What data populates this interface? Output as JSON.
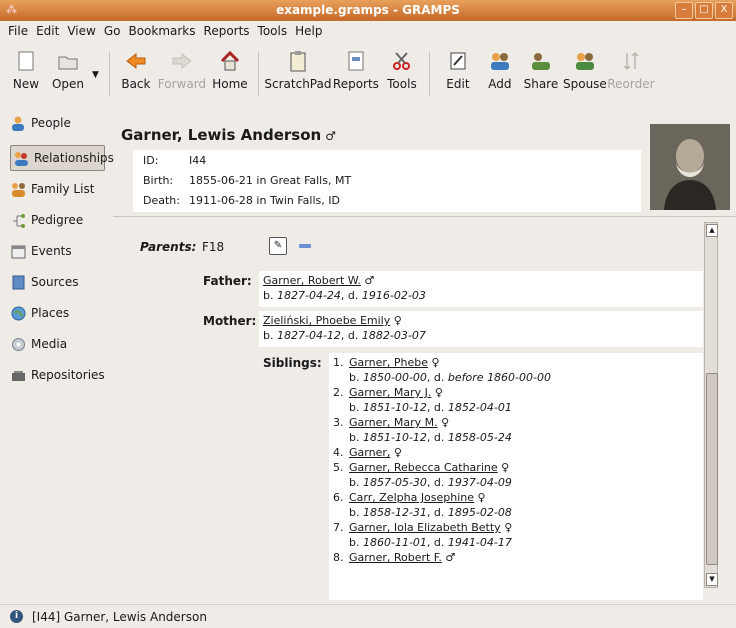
{
  "window": {
    "title": "example.gramps - GRAMPS",
    "buttons": [
      "–",
      "□",
      "X"
    ]
  },
  "menu": [
    "File",
    "Edit",
    "View",
    "Go",
    "Bookmarks",
    "Reports",
    "Tools",
    "Help"
  ],
  "toolbar": {
    "new": "New",
    "open": "Open",
    "back": "Back",
    "forward": "Forward",
    "home": "Home",
    "scratchpad": "ScratchPad",
    "reports": "Reports",
    "tools": "Tools",
    "edit": "Edit",
    "add": "Add",
    "share": "Share",
    "spouse": "Spouse",
    "reorder": "Reorder"
  },
  "sidebar": {
    "items": [
      {
        "label": "People",
        "icon": "people-icon"
      },
      {
        "label": "Relationships",
        "icon": "relationships-icon"
      },
      {
        "label": "Family List",
        "icon": "family-list-icon"
      },
      {
        "label": "Pedigree",
        "icon": "pedigree-icon"
      },
      {
        "label": "Events",
        "icon": "events-icon"
      },
      {
        "label": "Sources",
        "icon": "sources-icon"
      },
      {
        "label": "Places",
        "icon": "places-icon"
      },
      {
        "label": "Media",
        "icon": "media-icon"
      },
      {
        "label": "Repositories",
        "icon": "repositories-icon"
      }
    ],
    "active": "Relationships"
  },
  "person": {
    "name": "Garner, Lewis Anderson",
    "sex": "♂",
    "id_label": "ID:",
    "id": "I44",
    "birth_label": "Birth:",
    "birth": "1855-06-21 in Great Falls, MT",
    "death_label": "Death:",
    "death": "1911-06-28 in Twin Falls, ID"
  },
  "family": {
    "parents_label": "Parents:",
    "family_id": "F18",
    "father_label": "Father:",
    "father": {
      "name": "Garner, Robert W.",
      "sex": "♂",
      "b": "1827-04-24",
      "d": "1916-02-03"
    },
    "mother_label": "Mother:",
    "mother": {
      "name": "Zieliński, Phoebe Emily",
      "sex": "♀",
      "b": "1827-04-12",
      "d": "1882-03-07"
    },
    "siblings_label": "Siblings:",
    "siblings": [
      {
        "num": "1.",
        "name": "Garner, Phebe",
        "sex": "♀",
        "b": "1850-00-00",
        "d_prefix": "before",
        "d": "1860-00-00"
      },
      {
        "num": "2.",
        "name": "Garner, Mary J.",
        "sex": "♀",
        "b": "1851-10-12",
        "d": "1852-04-01"
      },
      {
        "num": "3.",
        "name": "Garner, Mary M.",
        "sex": "♀",
        "b": "1851-10-12",
        "d": "1858-05-24"
      },
      {
        "num": "4.",
        "name": "Garner,",
        "sex": "♀"
      },
      {
        "num": "5.",
        "name": "Garner, Rebecca Catharine",
        "sex": "♀",
        "b": "1857-05-30",
        "d": "1937-04-09"
      },
      {
        "num": "6.",
        "name": "Carr, Zelpha Josephine",
        "sex": "♀",
        "b": "1858-12-31",
        "d": "1895-02-08"
      },
      {
        "num": "7.",
        "name": "Garner, Iola Elizabeth Betty",
        "sex": "♀",
        "b": "1860-11-01",
        "d": "1941-04-17"
      },
      {
        "num": "8.",
        "name": "Garner, Robert F.",
        "sex": "♂"
      }
    ]
  },
  "status": "[I44] Garner, Lewis Anderson",
  "labels": {
    "b": "b.",
    "d": "d."
  }
}
